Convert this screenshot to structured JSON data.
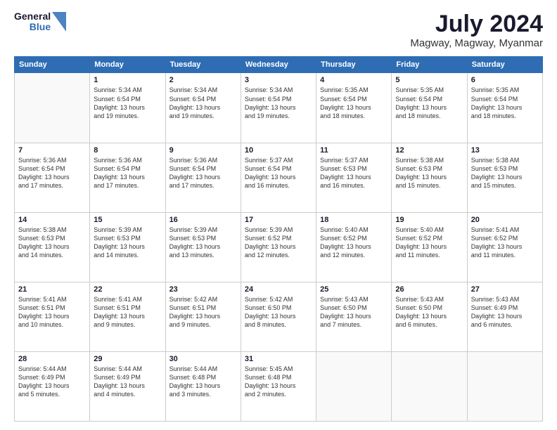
{
  "header": {
    "logo_line1": "General",
    "logo_line2": "Blue",
    "month_year": "July 2024",
    "location": "Magway, Magway, Myanmar"
  },
  "days_of_week": [
    "Sunday",
    "Monday",
    "Tuesday",
    "Wednesday",
    "Thursday",
    "Friday",
    "Saturday"
  ],
  "weeks": [
    [
      {
        "day": "",
        "info": ""
      },
      {
        "day": "1",
        "info": "Sunrise: 5:34 AM\nSunset: 6:54 PM\nDaylight: 13 hours\nand 19 minutes."
      },
      {
        "day": "2",
        "info": "Sunrise: 5:34 AM\nSunset: 6:54 PM\nDaylight: 13 hours\nand 19 minutes."
      },
      {
        "day": "3",
        "info": "Sunrise: 5:34 AM\nSunset: 6:54 PM\nDaylight: 13 hours\nand 19 minutes."
      },
      {
        "day": "4",
        "info": "Sunrise: 5:35 AM\nSunset: 6:54 PM\nDaylight: 13 hours\nand 18 minutes."
      },
      {
        "day": "5",
        "info": "Sunrise: 5:35 AM\nSunset: 6:54 PM\nDaylight: 13 hours\nand 18 minutes."
      },
      {
        "day": "6",
        "info": "Sunrise: 5:35 AM\nSunset: 6:54 PM\nDaylight: 13 hours\nand 18 minutes."
      }
    ],
    [
      {
        "day": "7",
        "info": "Sunrise: 5:36 AM\nSunset: 6:54 PM\nDaylight: 13 hours\nand 17 minutes."
      },
      {
        "day": "8",
        "info": "Sunrise: 5:36 AM\nSunset: 6:54 PM\nDaylight: 13 hours\nand 17 minutes."
      },
      {
        "day": "9",
        "info": "Sunrise: 5:36 AM\nSunset: 6:54 PM\nDaylight: 13 hours\nand 17 minutes."
      },
      {
        "day": "10",
        "info": "Sunrise: 5:37 AM\nSunset: 6:54 PM\nDaylight: 13 hours\nand 16 minutes."
      },
      {
        "day": "11",
        "info": "Sunrise: 5:37 AM\nSunset: 6:53 PM\nDaylight: 13 hours\nand 16 minutes."
      },
      {
        "day": "12",
        "info": "Sunrise: 5:38 AM\nSunset: 6:53 PM\nDaylight: 13 hours\nand 15 minutes."
      },
      {
        "day": "13",
        "info": "Sunrise: 5:38 AM\nSunset: 6:53 PM\nDaylight: 13 hours\nand 15 minutes."
      }
    ],
    [
      {
        "day": "14",
        "info": "Sunrise: 5:38 AM\nSunset: 6:53 PM\nDaylight: 13 hours\nand 14 minutes."
      },
      {
        "day": "15",
        "info": "Sunrise: 5:39 AM\nSunset: 6:53 PM\nDaylight: 13 hours\nand 14 minutes."
      },
      {
        "day": "16",
        "info": "Sunrise: 5:39 AM\nSunset: 6:53 PM\nDaylight: 13 hours\nand 13 minutes."
      },
      {
        "day": "17",
        "info": "Sunrise: 5:39 AM\nSunset: 6:52 PM\nDaylight: 13 hours\nand 12 minutes."
      },
      {
        "day": "18",
        "info": "Sunrise: 5:40 AM\nSunset: 6:52 PM\nDaylight: 13 hours\nand 12 minutes."
      },
      {
        "day": "19",
        "info": "Sunrise: 5:40 AM\nSunset: 6:52 PM\nDaylight: 13 hours\nand 11 minutes."
      },
      {
        "day": "20",
        "info": "Sunrise: 5:41 AM\nSunset: 6:52 PM\nDaylight: 13 hours\nand 11 minutes."
      }
    ],
    [
      {
        "day": "21",
        "info": "Sunrise: 5:41 AM\nSunset: 6:51 PM\nDaylight: 13 hours\nand 10 minutes."
      },
      {
        "day": "22",
        "info": "Sunrise: 5:41 AM\nSunset: 6:51 PM\nDaylight: 13 hours\nand 9 minutes."
      },
      {
        "day": "23",
        "info": "Sunrise: 5:42 AM\nSunset: 6:51 PM\nDaylight: 13 hours\nand 9 minutes."
      },
      {
        "day": "24",
        "info": "Sunrise: 5:42 AM\nSunset: 6:50 PM\nDaylight: 13 hours\nand 8 minutes."
      },
      {
        "day": "25",
        "info": "Sunrise: 5:43 AM\nSunset: 6:50 PM\nDaylight: 13 hours\nand 7 minutes."
      },
      {
        "day": "26",
        "info": "Sunrise: 5:43 AM\nSunset: 6:50 PM\nDaylight: 13 hours\nand 6 minutes."
      },
      {
        "day": "27",
        "info": "Sunrise: 5:43 AM\nSunset: 6:49 PM\nDaylight: 13 hours\nand 6 minutes."
      }
    ],
    [
      {
        "day": "28",
        "info": "Sunrise: 5:44 AM\nSunset: 6:49 PM\nDaylight: 13 hours\nand 5 minutes."
      },
      {
        "day": "29",
        "info": "Sunrise: 5:44 AM\nSunset: 6:49 PM\nDaylight: 13 hours\nand 4 minutes."
      },
      {
        "day": "30",
        "info": "Sunrise: 5:44 AM\nSunset: 6:48 PM\nDaylight: 13 hours\nand 3 minutes."
      },
      {
        "day": "31",
        "info": "Sunrise: 5:45 AM\nSunset: 6:48 PM\nDaylight: 13 hours\nand 2 minutes."
      },
      {
        "day": "",
        "info": ""
      },
      {
        "day": "",
        "info": ""
      },
      {
        "day": "",
        "info": ""
      }
    ]
  ]
}
